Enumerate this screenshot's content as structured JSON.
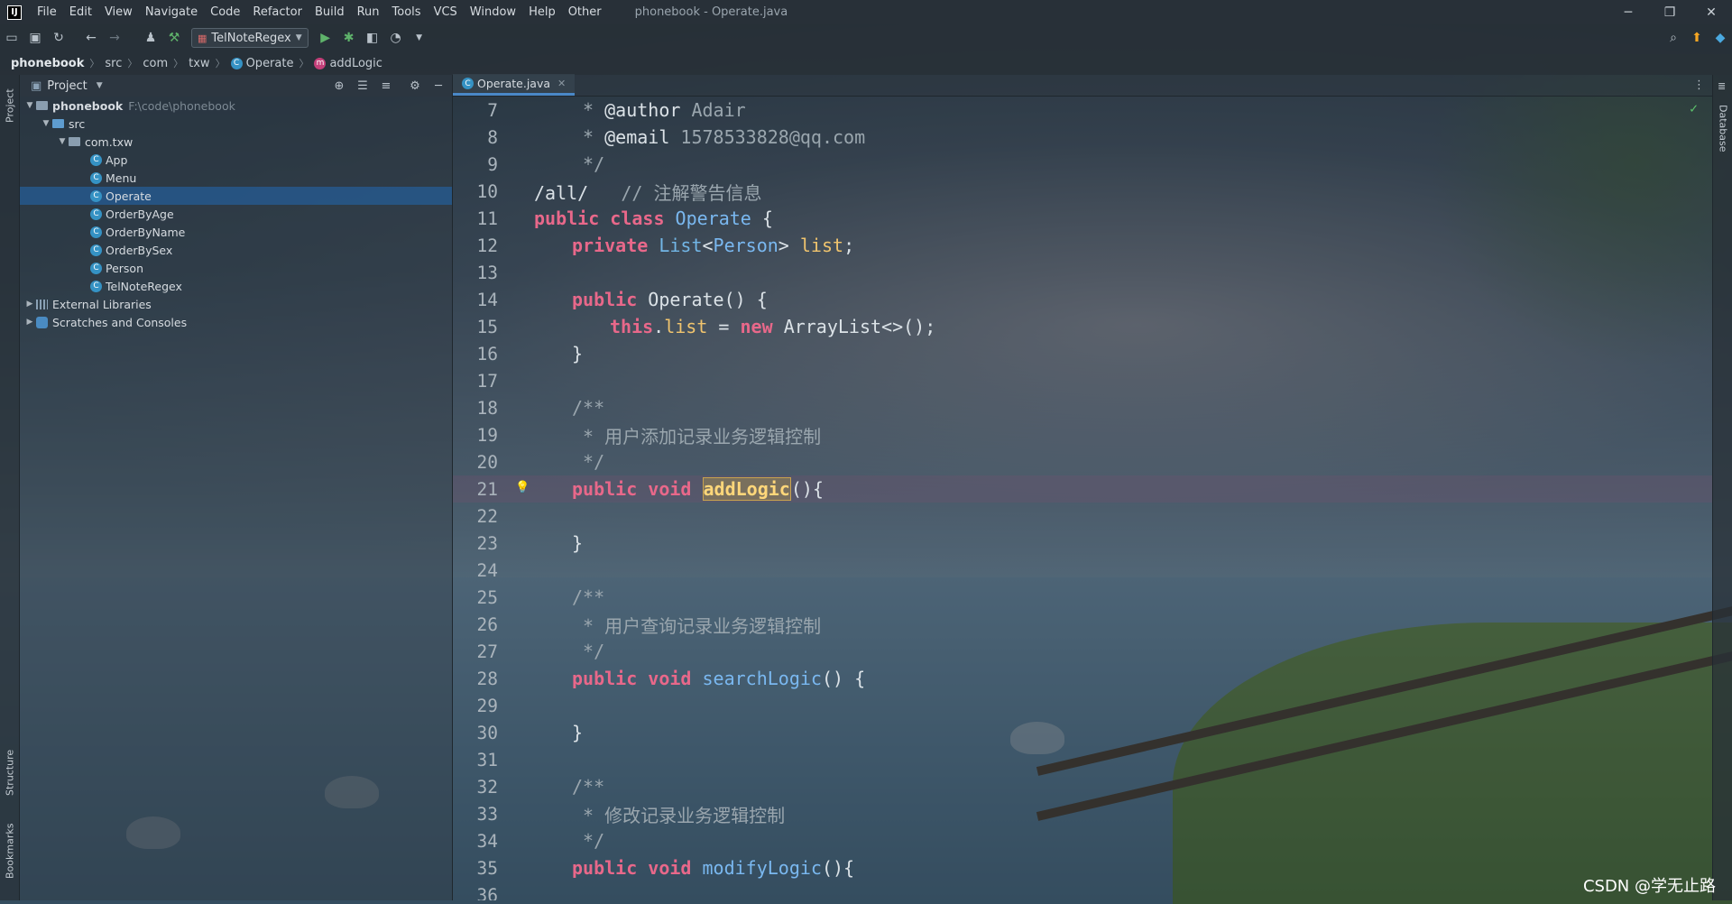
{
  "menubar": {
    "logo": "IJ",
    "items": [
      "File",
      "Edit",
      "View",
      "Navigate",
      "Code",
      "Refactor",
      "Build",
      "Run",
      "Tools",
      "VCS",
      "Window",
      "Help",
      "Other"
    ],
    "window_title": "phonebook - Operate.java",
    "controls": [
      "─",
      "❐",
      "✕"
    ]
  },
  "toolbar": {
    "run_config": "TelNoteRegex"
  },
  "breadcrumbs": {
    "items": [
      "phonebook",
      "src",
      "com",
      "txw",
      "Operate",
      "addLogic"
    ]
  },
  "left_strip": {
    "project": "Project",
    "structure": "Structure",
    "bookmarks": "Bookmarks"
  },
  "right_strip": {
    "database": "Database"
  },
  "project_panel": {
    "title": "Project",
    "root": {
      "name": "phonebook",
      "path": "F:\\code\\phonebook"
    },
    "src": "src",
    "package": "com.txw",
    "classes": [
      "App",
      "Menu",
      "Operate",
      "OrderByAge",
      "OrderByName",
      "OrderBySex",
      "Person",
      "TelNoteRegex"
    ],
    "selected": "Operate",
    "external": "External Libraries",
    "scratches": "Scratches and Consoles"
  },
  "editor": {
    "tab": "Operate.java",
    "lines": [
      {
        "n": "7",
        "parts": [
          [
            " * ",
            "cm"
          ],
          [
            "@author",
            "txt"
          ],
          [
            " Adair",
            "cm"
          ]
        ],
        "indent": 1
      },
      {
        "n": "8",
        "parts": [
          [
            " * ",
            "cm"
          ],
          [
            "@email",
            "txt"
          ],
          [
            " 1578533828@qq.com",
            "cm"
          ]
        ],
        "indent": 1
      },
      {
        "n": "9",
        "parts": [
          [
            " */",
            "cm"
          ]
        ],
        "indent": 1
      },
      {
        "n": "10",
        "parts": [
          [
            "/all/",
            "txt"
          ],
          [
            "   // 注解警告信息",
            "cm"
          ]
        ],
        "indent": 0
      },
      {
        "n": "11",
        "parts": [
          [
            "public class ",
            "kw"
          ],
          [
            "Operate",
            "fn"
          ],
          [
            " {",
            "txt"
          ]
        ],
        "indent": 0
      },
      {
        "n": "12",
        "parts": [
          [
            "private ",
            "kw"
          ],
          [
            "List",
            "tp"
          ],
          [
            "<",
            "txt"
          ],
          [
            "Person",
            "fn"
          ],
          [
            "> ",
            "txt"
          ],
          [
            "list",
            "fld"
          ],
          [
            ";",
            "txt"
          ]
        ],
        "indent": 1
      },
      {
        "n": "13",
        "parts": [],
        "indent": 0
      },
      {
        "n": "14",
        "parts": [
          [
            "public ",
            "kw"
          ],
          [
            "Operate() {",
            "txt"
          ]
        ],
        "indent": 1
      },
      {
        "n": "15",
        "parts": [
          [
            "this",
            "kw"
          ],
          [
            ".",
            "txt"
          ],
          [
            "list",
            "fld"
          ],
          [
            " = ",
            "txt"
          ],
          [
            "new ",
            "kw"
          ],
          [
            "ArrayList<>();",
            "txt"
          ]
        ],
        "indent": 2
      },
      {
        "n": "16",
        "parts": [
          [
            "}",
            "txt"
          ]
        ],
        "indent": 1
      },
      {
        "n": "17",
        "parts": [],
        "indent": 0
      },
      {
        "n": "18",
        "parts": [
          [
            "/**",
            "cm"
          ]
        ],
        "indent": 1
      },
      {
        "n": "19",
        "parts": [
          [
            " * 用户添加记录业务逻辑控制",
            "cm"
          ]
        ],
        "indent": 1
      },
      {
        "n": "20",
        "parts": [
          [
            " */",
            "cm"
          ]
        ],
        "indent": 1
      },
      {
        "n": "21",
        "parts": [
          [
            "public void ",
            "kw"
          ],
          [
            "addLogic",
            "sel-fn"
          ],
          [
            "(){",
            "txt"
          ]
        ],
        "indent": 1,
        "highlight": true,
        "bulb": true
      },
      {
        "n": "22",
        "parts": [],
        "indent": 0
      },
      {
        "n": "23",
        "parts": [
          [
            "}",
            "txt"
          ]
        ],
        "indent": 1
      },
      {
        "n": "24",
        "parts": [],
        "indent": 0
      },
      {
        "n": "25",
        "parts": [
          [
            "/**",
            "cm"
          ]
        ],
        "indent": 1
      },
      {
        "n": "26",
        "parts": [
          [
            " * 用户查询记录业务逻辑控制",
            "cm"
          ]
        ],
        "indent": 1
      },
      {
        "n": "27",
        "parts": [
          [
            " */",
            "cm"
          ]
        ],
        "indent": 1
      },
      {
        "n": "28",
        "parts": [
          [
            "public void ",
            "kw"
          ],
          [
            "searchLogic",
            "fn"
          ],
          [
            "() {",
            "txt"
          ]
        ],
        "indent": 1
      },
      {
        "n": "29",
        "parts": [],
        "indent": 0
      },
      {
        "n": "30",
        "parts": [
          [
            "}",
            "txt"
          ]
        ],
        "indent": 1
      },
      {
        "n": "31",
        "parts": [],
        "indent": 0
      },
      {
        "n": "32",
        "parts": [
          [
            "/**",
            "cm"
          ]
        ],
        "indent": 1
      },
      {
        "n": "33",
        "parts": [
          [
            " * 修改记录业务逻辑控制",
            "cm"
          ]
        ],
        "indent": 1
      },
      {
        "n": "34",
        "parts": [
          [
            " */",
            "cm"
          ]
        ],
        "indent": 1
      },
      {
        "n": "35",
        "parts": [
          [
            "public void ",
            "kw"
          ],
          [
            "modifyLogic",
            "fn"
          ],
          [
            "(){",
            "txt"
          ]
        ],
        "indent": 1
      },
      {
        "n": "36",
        "parts": [],
        "indent": 0
      }
    ]
  },
  "watermark": "CSDN @学无止路",
  "colors": {
    "keyword": "#e8688a",
    "comment": "#9aa6ae",
    "selection": "#26588c"
  }
}
